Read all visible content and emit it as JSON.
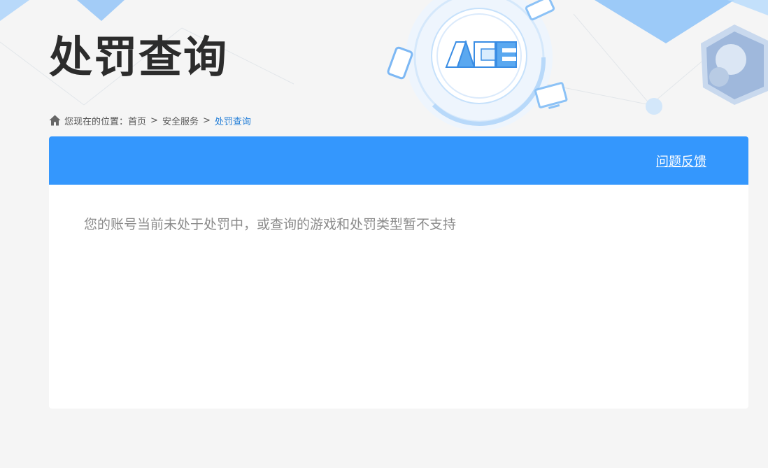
{
  "header": {
    "title": "处罚查询",
    "logo_text": "ACE",
    "badges": [
      "GAME",
      "GAME",
      "GAME"
    ]
  },
  "breadcrumb": {
    "prefix": "您现在的位置：",
    "items": [
      "首页",
      "安全服务",
      "处罚查询"
    ],
    "separator": ">"
  },
  "panel": {
    "feedback_label": "问题反馈",
    "message": "您的账号当前未处于处罚中，或查询的游戏和处罚类型暂不支持"
  },
  "colors": {
    "accent": "#3497fd",
    "breadcrumb_current": "#2a82d8",
    "title": "#2c2c2c",
    "message": "#8b8b8b",
    "background": "#f5f5f5"
  },
  "icons": [
    "home-icon",
    "ace-logo",
    "gamepad-icon",
    "monitor-icon"
  ]
}
